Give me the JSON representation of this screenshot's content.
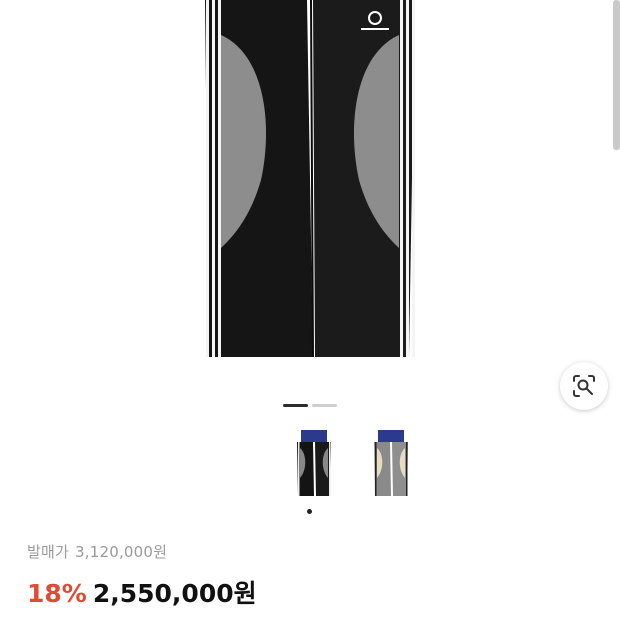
{
  "product": {
    "image_alt": "black track pants with white side stripes and grey mesh panels",
    "gallery_count": 2,
    "gallery_active": 1
  },
  "thumbnails": [
    {
      "name": "black-navy"
    },
    {
      "name": "grey-navy"
    }
  ],
  "price": {
    "original_label": "발매가",
    "original_value": "3,120,000원",
    "discount": "18%",
    "sale_value": "2,550,000원"
  },
  "colors": {
    "discount": "#e04b34",
    "muted": "#9a9a9a",
    "text": "#111111"
  }
}
